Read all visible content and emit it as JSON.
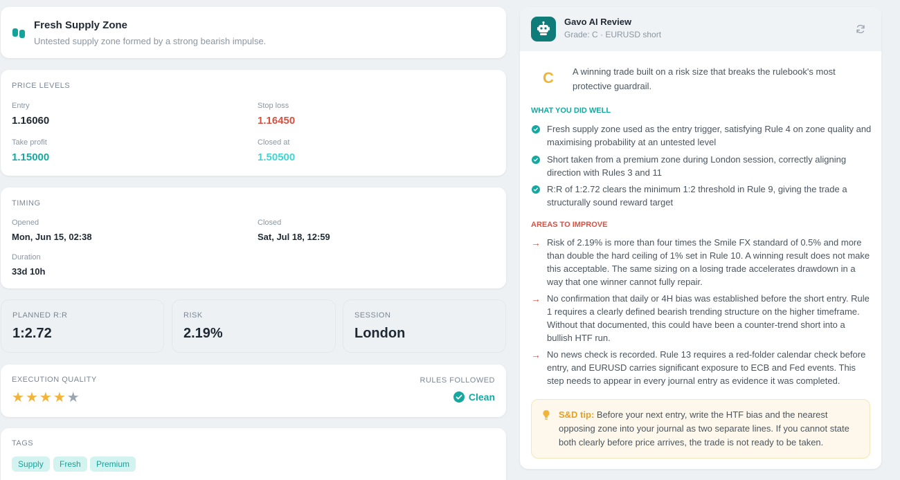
{
  "header": {
    "title": "Fresh Supply Zone",
    "subtitle": "Untested supply zone formed by a strong bearish impulse."
  },
  "price_levels": {
    "label": "PRICE LEVELS",
    "entry_label": "Entry",
    "entry": "1.16060",
    "stop_label": "Stop loss",
    "stop": "1.16450",
    "tp_label": "Take profit",
    "tp": "1.15000",
    "closed_label": "Closed at",
    "closed": "1.50500"
  },
  "timing": {
    "label": "TIMING",
    "opened_label": "Opened",
    "opened": "Mon, Jun 15, 02:38",
    "closed_label": "Closed",
    "closed": "Sat, Jul 18, 12:59",
    "duration_label": "Duration",
    "duration": "33d 10h"
  },
  "stats": {
    "rr_label": "PLANNED R:R",
    "rr": "1:2.72",
    "risk_label": "RISK",
    "risk": "2.19%",
    "session_label": "SESSION",
    "session": "London"
  },
  "execution": {
    "label": "EXECUTION QUALITY",
    "rating": 4,
    "max": 5,
    "rules_label": "RULES FOLLOWED",
    "rules_value": "Clean"
  },
  "tags": {
    "label": "TAGS",
    "items": [
      "Supply",
      "Fresh",
      "Premium"
    ]
  },
  "review": {
    "title": "Gavo AI Review",
    "subtitle": "Grade: C · EURUSD short",
    "grade": "C",
    "summary": "A winning trade built on a risk size that breaks the rulebook's most protective guardrail.",
    "good_heading": "WHAT YOU DID WELL",
    "good": [
      "Fresh supply zone used as the entry trigger, satisfying Rule 4 on zone quality and maximising probability at an untested level",
      "Short taken from a premium zone during London session, correctly aligning direction with Rules 3 and 11",
      "R:R of 1:2.72 clears the minimum 1:2 threshold in Rule 9, giving the trade a structurally sound reward target"
    ],
    "improve_heading": "AREAS TO IMPROVE",
    "improve": [
      "Risk of 2.19% is more than four times the Smile FX standard of 0.5% and more than double the hard ceiling of 1% set in Rule 10. A winning result does not make this acceptable. The same sizing on a losing trade accelerates drawdown in a way that one winner cannot fully repair.",
      "No confirmation that daily or 4H bias was established before the short entry. Rule 1 requires a clearly defined bearish trending structure on the higher timeframe. Without that documented, this could have been a counter-trend short into a bullish HTF run.",
      "No news check is recorded. Rule 13 requires a red-folder calendar check before entry, and EURUSD carries significant exposure to ECB and Fed events. This step needs to appear in every journal entry as evidence it was completed."
    ],
    "tip_label": "S&D tip:",
    "tip": "Before your next entry, write the HTF bias and the nearest opposing zone into your journal as two separate lines. If you cannot state both clearly before price arrives, the trade is not ready to be taken."
  },
  "icons": {
    "header": "zone-icon",
    "bot": "robot-icon",
    "refresh": "refresh-icon",
    "check": "check-circle-icon",
    "arrow": "arrow-right-icon",
    "bulb": "lightbulb-icon",
    "star": "star-icon"
  },
  "colors": {
    "accent": "#15a8a0",
    "negative": "#d9503f",
    "star": "#f1b43a",
    "bot_bg": "#0f7c79"
  }
}
